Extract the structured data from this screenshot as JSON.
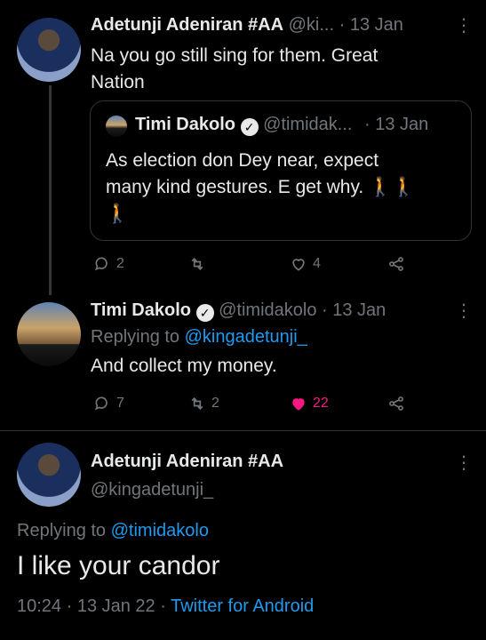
{
  "tweet1": {
    "author": "Adetunji Adeniran #AA",
    "handle": "@ki...",
    "date": "· 13 Jan",
    "text_line1": "Na you go still sing for them. Great",
    "text_line2": "Nation",
    "quote": {
      "author": "Timi Dakolo",
      "handle": "@timidak...",
      "date": "· 13 Jan",
      "text_line1": "As election don Dey near, expect",
      "text_line2": "many kind gestures. E get why. 🚶🚶",
      "text_line3": "🚶"
    },
    "replies": "2",
    "retweets": "",
    "likes": "4"
  },
  "tweet2": {
    "author": "Timi Dakolo",
    "handle": "@timidakolo · 13 Jan",
    "replying_prefix": "Replying to ",
    "replying_to": "@kingadetunji_",
    "text": "And collect my money.",
    "replies": "7",
    "retweets": "2",
    "likes": "22"
  },
  "main": {
    "author": "Adetunji Adeniran #AA",
    "handle": "@kingadetunji_",
    "replying_prefix": "Replying to ",
    "replying_to": "@timidakolo",
    "text": "I like your candor",
    "time": "10:24 · 13 Jan 22 · ",
    "source": "Twitter for Android"
  },
  "colors": {
    "background": "#000000",
    "link": "#1d9bf0",
    "like_active": "#f91880",
    "muted": "#71767b"
  },
  "icons": [
    "verified-icon",
    "more-icon",
    "reply-icon",
    "retweet-icon",
    "like-icon",
    "share-icon"
  ]
}
